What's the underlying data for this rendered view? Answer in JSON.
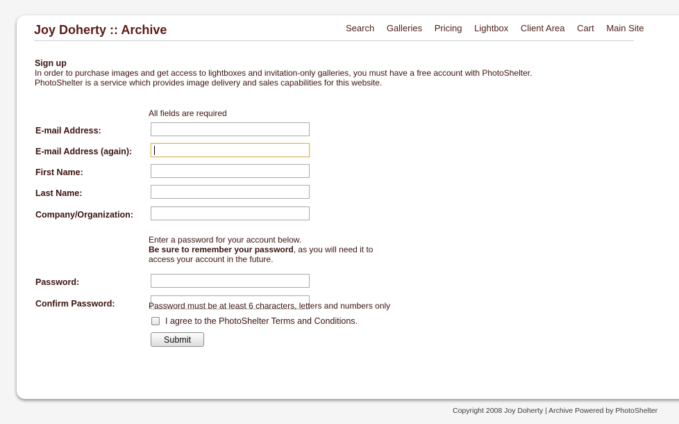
{
  "header": {
    "title": "Joy Doherty :: Archive",
    "nav": [
      "Search",
      "Galleries",
      "Pricing",
      "Lightbox",
      "Client Area",
      "Cart",
      "Main Site"
    ]
  },
  "intro": {
    "heading": "Sign up",
    "line1": "In order to purchase images and get access to lightboxes and invitation-only galleries, you must have a free account with PhotoShelter.",
    "line2": "PhotoShelter is a service which provides image delivery and sales capabilities for this website."
  },
  "form": {
    "required_note": "All fields are required",
    "email_label": "E-mail Address:",
    "email_value": "",
    "email_again_label": "E-mail Address (again):",
    "email_again_value": "",
    "first_name_label": "First Name:",
    "first_name_value": "",
    "last_name_label": "Last Name:",
    "last_name_value": "",
    "company_label": "Company/Organization:",
    "company_value": "",
    "password_note_1": "Enter a password for your account below.",
    "password_note_bold": "Be sure to remember your password",
    "password_note_2": ", as you will need it to",
    "password_note_3": "access your account in the future.",
    "password_label": "Password:",
    "confirm_password_label": "Confirm Password:",
    "password_rule": "Password must be at least 6 characters, letters and numbers only",
    "terms_label": "I agree to the PhotoShelter Terms and Conditions.",
    "terms_checked": false,
    "submit_label": "Submit"
  },
  "footer": {
    "copyright": "Copyright 2008 Joy Doherty | Archive Powered by PhotoShelter"
  },
  "colors": {
    "accent": "#5a1a16",
    "focus_border": "#e0b460"
  }
}
